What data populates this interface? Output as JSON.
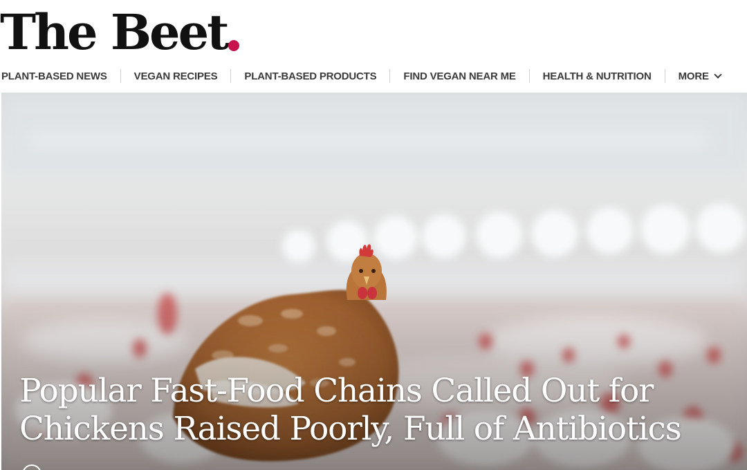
{
  "site": {
    "logo_text": "The Beet",
    "logo_dot_color": "#c8144c"
  },
  "nav": {
    "items": [
      {
        "label": "PLANT-BASED NEWS"
      },
      {
        "label": "VEGAN RECIPES"
      },
      {
        "label": "PLANT-BASED PRODUCTS"
      },
      {
        "label": "FIND VEGAN NEAR ME"
      },
      {
        "label": "HEALTH & NUTRITION"
      }
    ],
    "more_label": "MORE",
    "more_icon": "chevron-down-icon"
  },
  "hero": {
    "headline": "Popular Fast-Food Chains Called Out for Chickens Raised Poorly, Full of Antibiotics",
    "author_icon": "user-circle-icon"
  }
}
